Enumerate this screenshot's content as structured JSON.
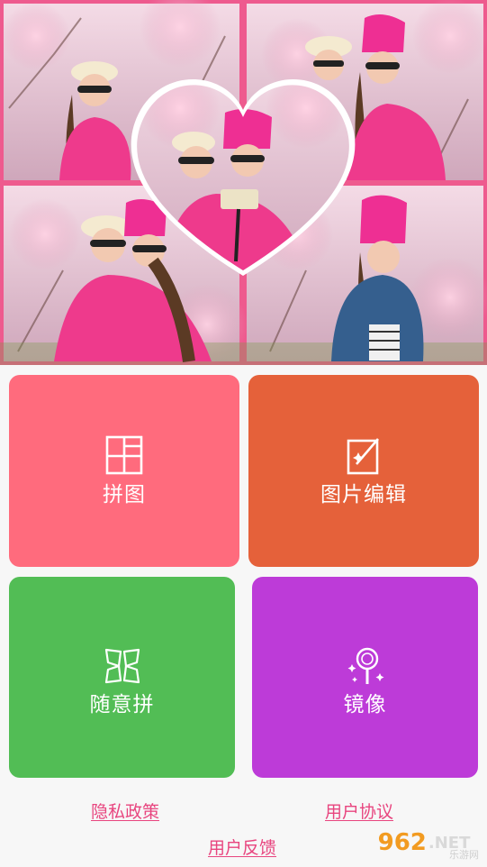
{
  "theme": {
    "collage_border": "#ee5a8e",
    "link_color": "#e8457f"
  },
  "tiles": [
    {
      "label": "拼图",
      "icon": "grid-layout-icon",
      "color": "#ff6b7d"
    },
    {
      "label": "图片编辑",
      "icon": "photo-edit-icon",
      "color": "#e5613a"
    },
    {
      "label": "随意拼",
      "icon": "freestyle-collage-icon",
      "color": "#52bd55"
    },
    {
      "label": "镜像",
      "icon": "mirror-icon",
      "color": "#bd3bd8"
    }
  ],
  "links": {
    "privacy": "隐私政策",
    "agreement": "用户协议",
    "feedback": "用户反馈"
  },
  "watermark": {
    "number": "962",
    "suffix": ".NET",
    "site_name": "乐游网"
  }
}
